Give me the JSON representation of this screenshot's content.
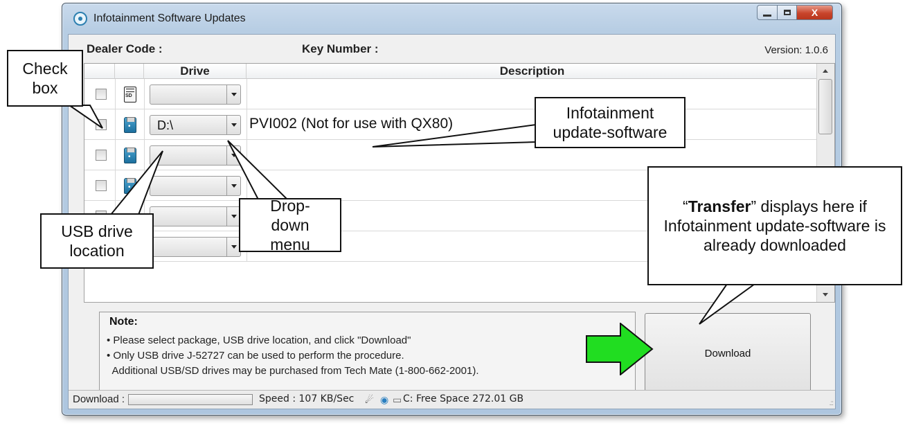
{
  "window": {
    "title": "Infotainment Software Updates",
    "controls": {
      "minimize": "–",
      "maximize": "□",
      "close": "X"
    }
  },
  "header": {
    "dealer_code_label": "Dealer Code :",
    "key_number_label": "Key Number :",
    "version": "Version: 1.0.6"
  },
  "grid": {
    "columns": [
      "",
      "",
      "Drive",
      "Description"
    ],
    "rows": [
      {
        "checked": false,
        "drive_type": "sd-card-icon",
        "drive": "",
        "description": ""
      },
      {
        "checked": false,
        "drive_type": "usb-drive-icon",
        "drive": "D:\\",
        "description": "PVI002 (Not for use with QX80)"
      },
      {
        "checked": false,
        "drive_type": "usb-drive-icon",
        "drive": "",
        "description": ""
      },
      {
        "checked": false,
        "drive_type": "usb-drive-icon",
        "drive": "",
        "description": ""
      },
      {
        "checked": false,
        "drive_type": "usb-drive-icon",
        "drive": "",
        "description": ""
      },
      {
        "checked": false,
        "drive_type": "usb-drive-icon",
        "drive": "",
        "description": ""
      }
    ]
  },
  "note": {
    "title": "Note:",
    "lines": [
      "• Please select package, USB drive location, and click \"Download\"",
      "• Only USB drive J-52727 can be used to perform the procedure.",
      "  Additional USB/SD drives may be purchased from Tech Mate (1-800-662-2001)."
    ]
  },
  "download_button": {
    "label": "Download"
  },
  "status_bar": {
    "download_label": "Download :",
    "progress": 0,
    "speed": "Speed : 107 KB/Sec",
    "free_space": "C: Free Space 272.01 GB",
    "icons": [
      "satellite-icon",
      "globe-icon",
      "hard-drive-icon"
    ]
  },
  "callouts": {
    "check_box": "Check box",
    "infotainment_software": "Infotainment update-software",
    "drop_down_menu": "Drop-down menu",
    "usb_drive_location": "USB drive location",
    "transfer_prefix": "“",
    "transfer_word": "Transfer",
    "transfer_suffix": "” displays here if Infotainment update-software is already downloaded"
  },
  "colors": {
    "accent_arrow": "#21dd21",
    "progress_fill": "#4cc24c",
    "close_button": "#c9452c"
  }
}
